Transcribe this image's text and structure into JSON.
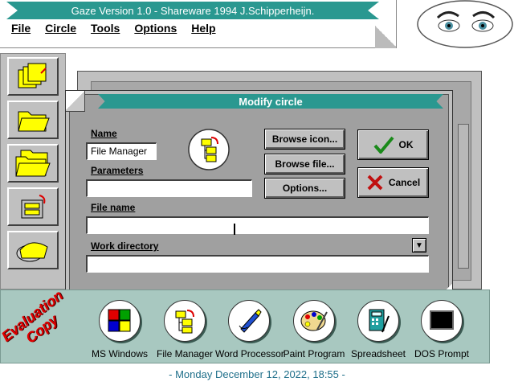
{
  "app": {
    "title": "Gaze Version 1.0 - Shareware 1994 J.Schipperheijn.",
    "menu": [
      "File",
      "Circle",
      "Tools",
      "Options",
      "Help"
    ]
  },
  "toolbar": {
    "icons": [
      "file-cabinet-icon",
      "open-folder-icon",
      "folders-icon",
      "cabinet-arrow-icon",
      "folder-disk-icon"
    ]
  },
  "dialog": {
    "title": "Modify circle",
    "name_label": "Name",
    "name_value": "File Manager",
    "parameters_label": "Parameters",
    "parameters_value": "",
    "filename_label": "File name",
    "filename_value": "",
    "workdir_label": "Work directory",
    "workdir_value": "",
    "browse_icon_label": "Browse icon...",
    "browse_file_label": "Browse file...",
    "options_label": "Options...",
    "ok_label": "OK",
    "cancel_label": "Cancel"
  },
  "launcher": {
    "watermark": [
      "Evaluation",
      "Copy"
    ],
    "items": [
      {
        "label": "MS Windows"
      },
      {
        "label": "File Manager"
      },
      {
        "label": "Word Processor"
      },
      {
        "label": "Paint Program"
      },
      {
        "label": "Spreadsheet"
      },
      {
        "label": "DOS Prompt"
      }
    ]
  },
  "status": {
    "datetime": "- Monday December 12, 2022, 18:55 -"
  },
  "colors": {
    "title_teal": "#2a9890",
    "launcher_bg": "#a8c8c0",
    "date_text": "#1f6f8a",
    "eval_red": "#e00000"
  }
}
